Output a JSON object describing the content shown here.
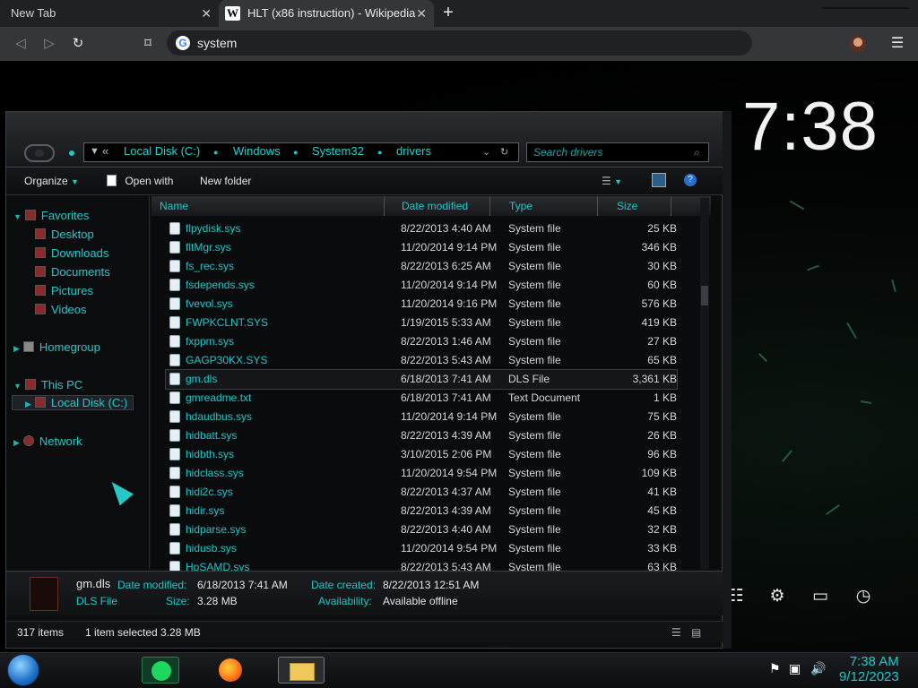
{
  "browser": {
    "tabs": [
      {
        "label": "New Tab"
      },
      {
        "label": "HLT (x86 instruction) - Wikipedia",
        "favicon": "W"
      }
    ],
    "omnibox_text": "system"
  },
  "desktop": {
    "clock": "7:38"
  },
  "explorer": {
    "breadcrumb": [
      "Local Disk (C:)",
      "Windows",
      "System32",
      "drivers"
    ],
    "search_placeholder": "Search drivers",
    "commands": {
      "organize": "Organize",
      "open_with": "Open with",
      "new_folder": "New folder"
    },
    "nav": {
      "favorites": "Favorites",
      "desktop": "Desktop",
      "downloads": "Downloads",
      "documents": "Documents",
      "pictures": "Pictures",
      "videos": "Videos",
      "homegroup": "Homegroup",
      "this_pc": "This PC",
      "local_disk": "Local Disk (C:)",
      "network": "Network"
    },
    "columns": [
      "Name",
      "Date modified",
      "Type",
      "Size"
    ],
    "files": [
      {
        "name": "flpydisk.sys",
        "date": "8/22/2013 4:40 AM",
        "type": "System file",
        "size": "25 KB"
      },
      {
        "name": "fltMgr.sys",
        "date": "11/20/2014 9:14 PM",
        "type": "System file",
        "size": "346 KB"
      },
      {
        "name": "fs_rec.sys",
        "date": "8/22/2013 6:25 AM",
        "type": "System file",
        "size": "30 KB"
      },
      {
        "name": "fsdepends.sys",
        "date": "11/20/2014 9:14 PM",
        "type": "System file",
        "size": "60 KB"
      },
      {
        "name": "fvevol.sys",
        "date": "11/20/2014 9:16 PM",
        "type": "System file",
        "size": "576 KB"
      },
      {
        "name": "FWPKCLNT.SYS",
        "date": "1/19/2015 5:33 AM",
        "type": "System file",
        "size": "419 KB"
      },
      {
        "name": "fxppm.sys",
        "date": "8/22/2013 1:46 AM",
        "type": "System file",
        "size": "27 KB"
      },
      {
        "name": "GAGP30KX.SYS",
        "date": "8/22/2013 5:43 AM",
        "type": "System file",
        "size": "65 KB"
      },
      {
        "name": "gm.dls",
        "date": "6/18/2013 7:41 AM",
        "type": "DLS File",
        "size": "3,361 KB"
      },
      {
        "name": "gmreadme.txt",
        "date": "6/18/2013 7:41 AM",
        "type": "Text Document",
        "size": "1 KB"
      },
      {
        "name": "hdaudbus.sys",
        "date": "11/20/2014 9:14 PM",
        "type": "System file",
        "size": "75 KB"
      },
      {
        "name": "hidbatt.sys",
        "date": "8/22/2013 4:39 AM",
        "type": "System file",
        "size": "26 KB"
      },
      {
        "name": "hidbth.sys",
        "date": "3/10/2015 2:06 PM",
        "type": "System file",
        "size": "96 KB"
      },
      {
        "name": "hidclass.sys",
        "date": "11/20/2014 9:54 PM",
        "type": "System file",
        "size": "109 KB"
      },
      {
        "name": "hidi2c.sys",
        "date": "8/22/2013 4:37 AM",
        "type": "System file",
        "size": "41 KB"
      },
      {
        "name": "hidir.sys",
        "date": "8/22/2013 4:39 AM",
        "type": "System file",
        "size": "45 KB"
      },
      {
        "name": "hidparse.sys",
        "date": "8/22/2013 4:40 AM",
        "type": "System file",
        "size": "32 KB"
      },
      {
        "name": "hidusb.sys",
        "date": "11/20/2014 9:54 PM",
        "type": "System file",
        "size": "33 KB"
      },
      {
        "name": "HpSAMD.sys",
        "date": "8/22/2013 5:43 AM",
        "type": "System file",
        "size": "63 KB"
      }
    ],
    "details": {
      "name": "gm.dls",
      "type": "DLS File",
      "date_modified_label": "Date modified:",
      "date_modified": "6/18/2013 7:41 AM",
      "size_label": "Size:",
      "size": "3.28 MB",
      "date_created_label": "Date created:",
      "date_created": "8/22/2013 12:51 AM",
      "availability_label": "Availability:",
      "availability": "Available offline"
    },
    "status": {
      "items": "317 items",
      "selected": "1 item selected  3.28 MB"
    }
  },
  "taskbar": {
    "time": "7:38 AM",
    "date": "9/12/2023"
  },
  "colors": {
    "accent": "#1cc9c9",
    "background": "#0a0b0d"
  }
}
